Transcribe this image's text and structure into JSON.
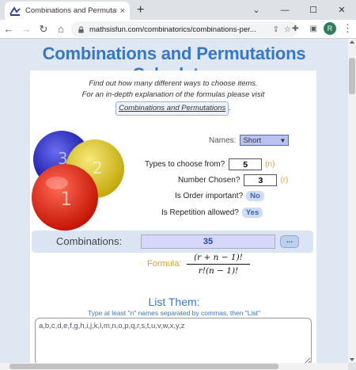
{
  "browser": {
    "tab_title": "Combinations and Permutations",
    "tab_close": "×",
    "new_tab": "+",
    "win_min": "—",
    "win_max": "☐",
    "win_close": "✕",
    "win_chevron": "⌄",
    "url": "mathsisfun.com/combinatorics/combinations-per...",
    "avatar_letter": "R"
  },
  "page": {
    "title": "Combinations and Permutations Calculator",
    "intro_line1": "Find out how many different ways to choose items.",
    "intro_line2": "For an in-depth explanation of the formulas please visit",
    "intro_link": "Combinations and Permutations",
    "intro_period": "."
  },
  "form": {
    "names_label": "Names:",
    "names_value": "Short",
    "types_label": "Types to choose from?",
    "types_value": "5",
    "types_var": "(n)",
    "chosen_label": "Number Chosen?",
    "chosen_value": "3",
    "chosen_var": "(r)",
    "order_label": "Is Order important?",
    "order_value": "No",
    "repeat_label": "Is Repetition allowed?",
    "repeat_value": "Yes"
  },
  "result": {
    "label": "Combinations:",
    "value": "35",
    "more": "...",
    "formula_label": "Formula:",
    "numerator": "(r + n − 1)!",
    "denominator": "r!(n − 1)!"
  },
  "list": {
    "title": "List Them:",
    "hint": "Type at least \"n\" names separated by commas, then \"List\"",
    "value": "a,b,c,d,e,f,g,h,i,j,k,l,m,n,o,p,q,r,s,t,u,v,w,x,y,z"
  },
  "colors": {
    "title_blue": "#3478c8",
    "ball_blue": "#1d1fb8",
    "ball_yellow": "#d9c21a",
    "ball_red": "#e51b0c",
    "formula_orange": "#e8a01c"
  }
}
